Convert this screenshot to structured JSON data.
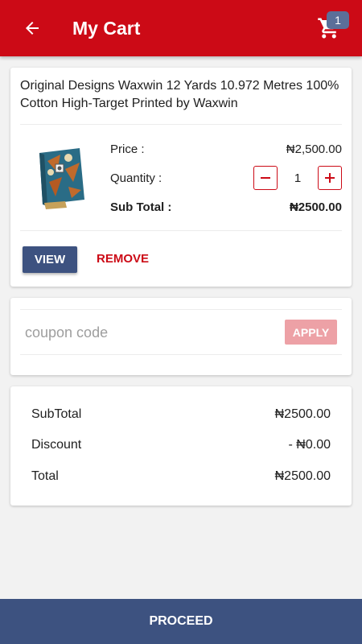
{
  "colors": {
    "primary": "#cc0a16",
    "accent": "#3d5280",
    "badge": "#5b6f99"
  },
  "header": {
    "title": "My Cart",
    "back_icon": "arrow-left-icon",
    "cart_icon": "shopping-cart-icon",
    "cart_count": "1"
  },
  "product": {
    "title": "Original Designs Waxwin 12 Yards 10.972 Metres 100% Cotton High-Target Printed by Waxwin",
    "price_label": "Price :",
    "price": "₦2,500.00",
    "quantity_label": "Quantity :",
    "quantity": "1",
    "subtotal_label": "Sub Total :",
    "subtotal": "₦2500.00",
    "view_label": "VIEW",
    "remove_label": "REMOVE"
  },
  "coupon": {
    "placeholder": "coupon code",
    "apply_label": "APPLY"
  },
  "summary": {
    "subtotal_label": "SubTotal",
    "subtotal": "₦2500.00",
    "discount_label": "Discount",
    "discount": "- ₦0.00",
    "total_label": "Total",
    "total": "₦2500.00"
  },
  "footer": {
    "proceed_label": "PROCEED"
  }
}
